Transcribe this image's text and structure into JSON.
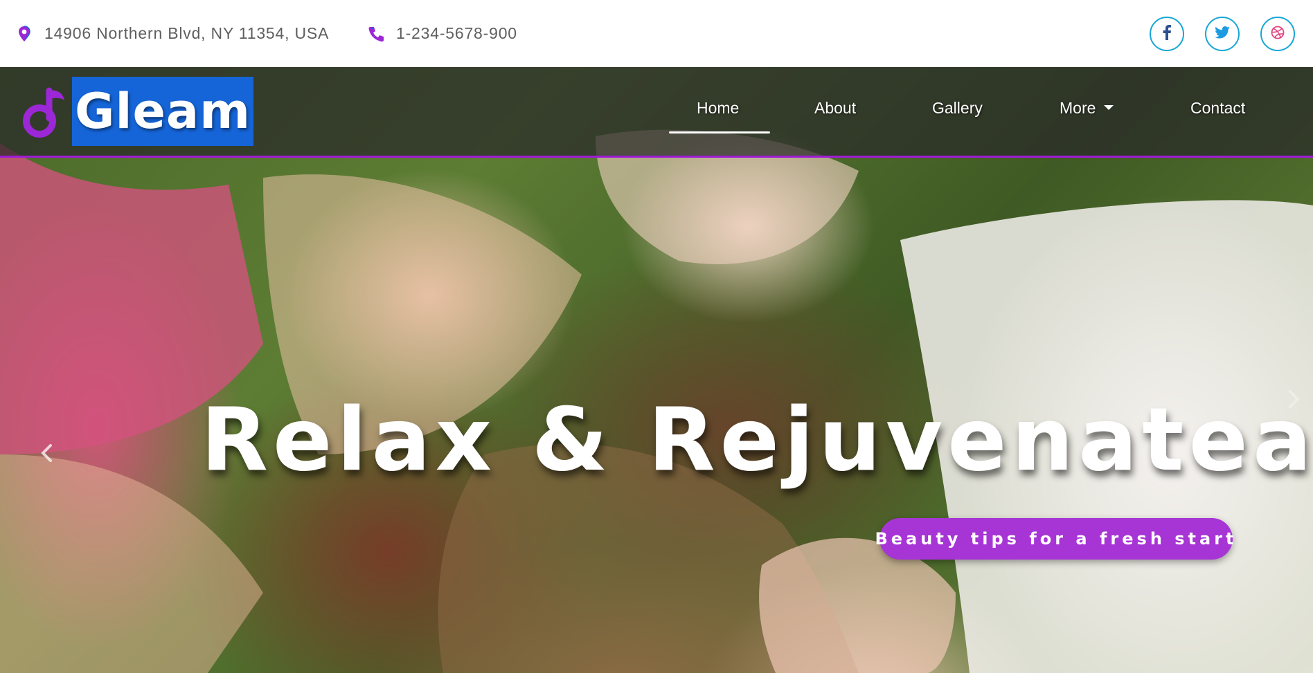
{
  "topbar": {
    "address": {
      "icon": "map-pin-icon",
      "text": "14906 Northern Blvd, NY 11354, USA"
    },
    "phone": {
      "icon": "phone-icon",
      "text": "1-234-5678-900"
    },
    "social": [
      {
        "icon": "facebook-icon",
        "label": "f"
      },
      {
        "icon": "twitter-icon"
      },
      {
        "icon": "dribbble-icon"
      }
    ]
  },
  "brand": {
    "icon": "music-note-icon",
    "name": "Gleam"
  },
  "nav": {
    "items": [
      {
        "label": "Home",
        "active": true
      },
      {
        "label": "About"
      },
      {
        "label": "Gallery"
      },
      {
        "label": "More",
        "dropdown": true
      },
      {
        "label": "Contact"
      }
    ]
  },
  "hero": {
    "title": "Relax & Rejuvenatea",
    "button_label": "Beauty tips for a fresh start",
    "prev_icon": "chevron-left-icon",
    "next_icon": "chevron-right-icon"
  },
  "colors": {
    "accent_purple": "#a735d5",
    "nav_border": "#a01bd6",
    "brand_highlight": "#1565d8",
    "social_border": "#17a6d6",
    "topbar_text": "#5f5f5f"
  }
}
